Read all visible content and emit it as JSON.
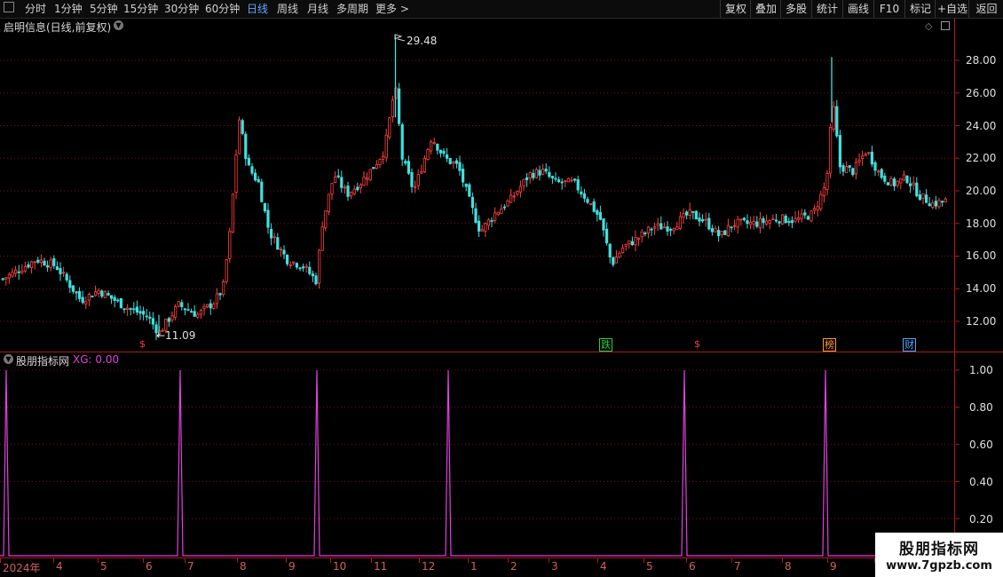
{
  "toolbar": {
    "periods": [
      "分时",
      "1分钟",
      "5分钟",
      "15分钟",
      "30分钟",
      "60分钟",
      "日线",
      "周线",
      "月线",
      "多周期",
      "更多 >"
    ],
    "active": "日线",
    "right_buttons": [
      "复权",
      "叠加",
      "多股",
      "统计",
      "画线",
      "F10",
      "标记",
      "+自选",
      "返回"
    ]
  },
  "main": {
    "title": "启明信息(日线,前复权)",
    "high_marker": "29.48",
    "low_marker": "←11.09",
    "y_ticks": [
      "28.00",
      "26.00",
      "24.00",
      "22.00",
      "20.00",
      "18.00",
      "16.00",
      "14.00",
      "12.00"
    ],
    "events": [
      {
        "label": "$",
        "color": "#ff3b3b"
      },
      {
        "label": "跌",
        "color": "#22d04a"
      },
      {
        "label": "$",
        "color": "#ff3b3b"
      },
      {
        "label": "榜",
        "color": "#ff9a33"
      },
      {
        "label": "财",
        "color": "#4aa8ff"
      }
    ]
  },
  "indicator": {
    "name": "股朋指标网",
    "xg_label": "XG: 0.00",
    "y_ticks": [
      "1.00",
      "0.80",
      "0.60",
      "0.40",
      "0.20"
    ],
    "line_color": "#e040e0"
  },
  "x_axis": [
    "2024年",
    "4",
    "5",
    "6",
    "7",
    "8",
    "9",
    "10",
    "11",
    "12",
    "1",
    "2",
    "3",
    "4",
    "5",
    "6",
    "7",
    "8",
    "9"
  ],
  "watermark": {
    "line1": "股朋指标网",
    "line2": "www.7gpzb.com"
  },
  "colors": {
    "up": "#ff4040",
    "down": "#40e0e0",
    "grid": "#7a1010",
    "axis": "#b01818"
  }
}
